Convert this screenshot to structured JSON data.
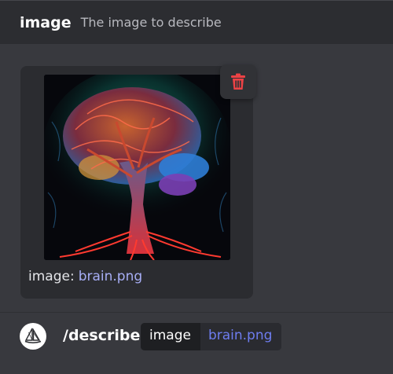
{
  "header": {
    "option_name": "image",
    "option_description": "The image to describe"
  },
  "attachment": {
    "caption_label": "image:",
    "filename": "brain.png",
    "image_alt": "Illustration of a tree whose crown forms a glowing brain",
    "delete_icon": "trash-icon"
  },
  "command_bar": {
    "avatar_icon": "sailboat-icon",
    "command": "/describe",
    "param_name": "image",
    "param_value": "brain.png"
  },
  "colors": {
    "background": "#38393e",
    "header_bg": "#2c2d31",
    "card_bg": "#2b2c30",
    "link": "#a7aef5",
    "param_value": "#6e7df0",
    "danger": "#ed4245"
  }
}
